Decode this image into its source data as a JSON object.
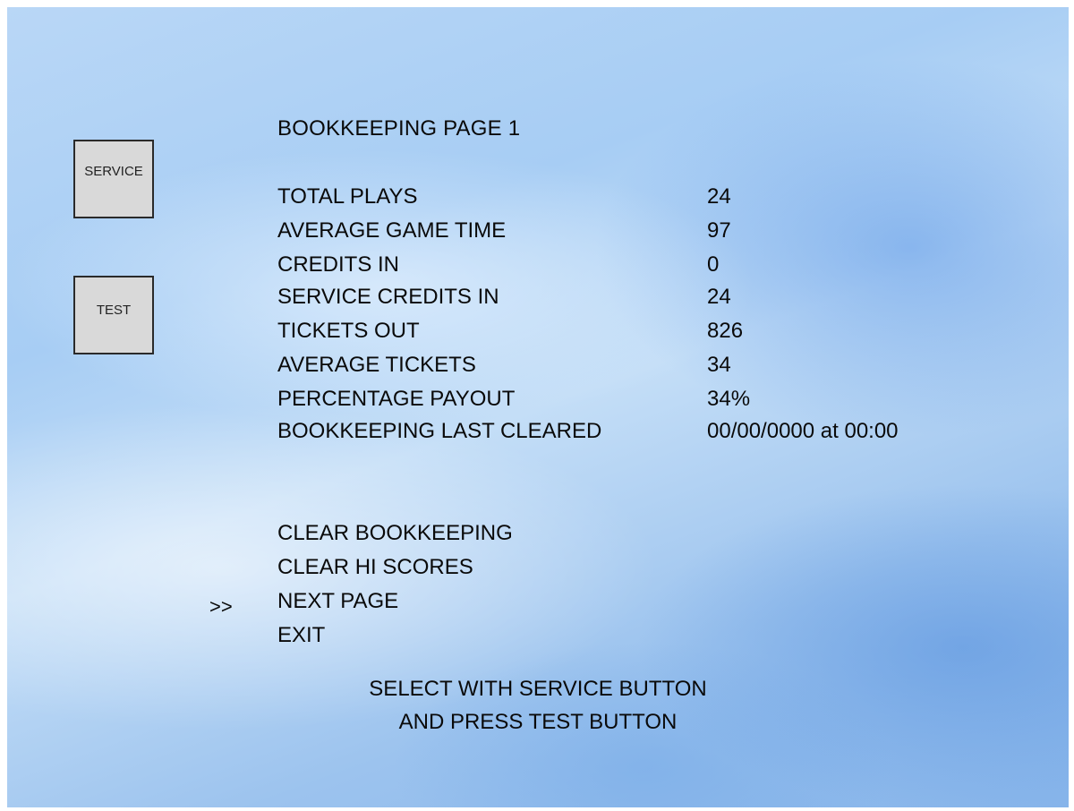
{
  "buttons": {
    "service": "SERVICE",
    "test": "TEST"
  },
  "title": "BOOKKEEPING PAGE 1",
  "stats": [
    {
      "label": "TOTAL PLAYS",
      "value": "24"
    },
    {
      "label": "AVERAGE GAME TIME",
      "value": "97"
    },
    {
      "label": "CREDITS IN",
      "value": "0"
    },
    {
      "label": "SERVICE CREDITS IN",
      "value": "24"
    },
    {
      "label": "TICKETS OUT",
      "value": "826"
    },
    {
      "label": "AVERAGE TICKETS",
      "value": "34"
    },
    {
      "label": "PERCENTAGE PAYOUT",
      "value": "34%"
    },
    {
      "label": "BOOKKEEPING LAST CLEARED",
      "value": "00/00/0000 at 00:00"
    }
  ],
  "menu": {
    "cursor": ">>",
    "selected_index": 2,
    "items": [
      {
        "label": "CLEAR BOOKKEEPING"
      },
      {
        "label": "CLEAR HI SCORES"
      },
      {
        "label": "NEXT PAGE"
      },
      {
        "label": "EXIT"
      }
    ]
  },
  "instructions": {
    "line1": "SELECT WITH SERVICE BUTTON",
    "line2": "AND PRESS TEST BUTTON"
  }
}
